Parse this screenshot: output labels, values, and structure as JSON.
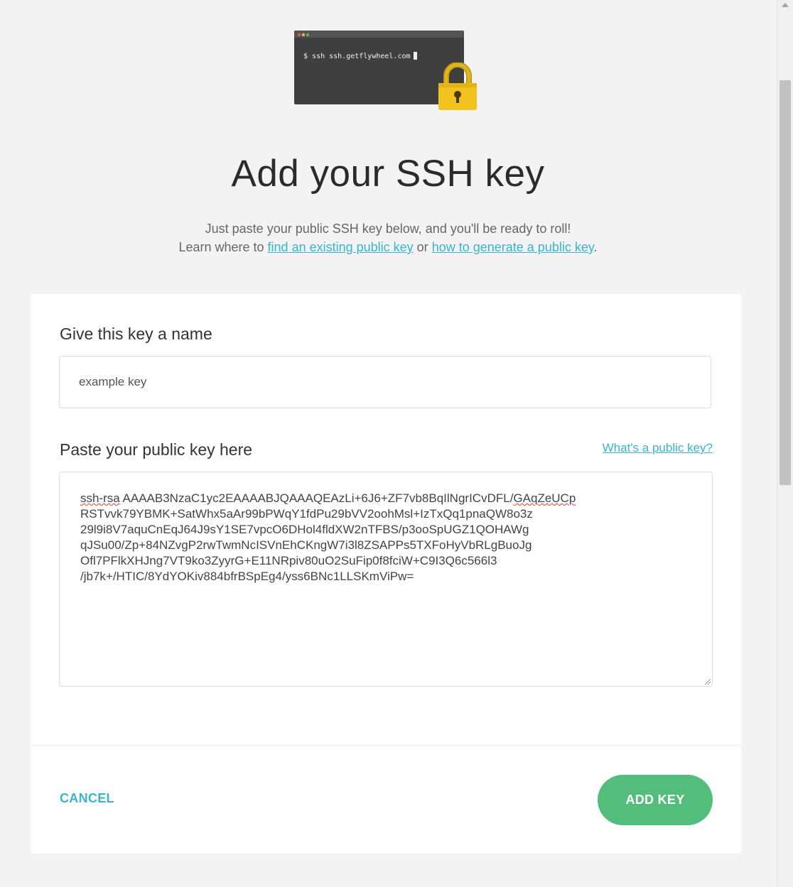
{
  "hero": {
    "terminal_command": "$ ssh ssh.getflywheel.com",
    "terminal_icon": "terminal-window-icon",
    "lock_icon": "padlock-icon"
  },
  "title": "Add your SSH key",
  "subtitle": {
    "line1": "Just paste your public SSH key below, and you'll be ready to roll!",
    "line2_prefix": "Learn where to ",
    "link1": "find an existing public key",
    "middle": " or ",
    "link2": "how to generate a public key",
    "suffix": "."
  },
  "form": {
    "name_label": "Give this key a name",
    "name_value": "example key",
    "key_label": "Paste your public key here",
    "help_link": "What's a public key?",
    "key_prefix": "ssh-rsa",
    "key_part_a": " AAAAB3NzaC1yc2EAAAABJQAAAQEAzLi+6J6+ZF7vb8BqIlNgrICvDFL/",
    "key_flagged": "GAqZeUCp",
    "key_part_b": "\nRSTvvk79YBMK+SatWhx5aAr99bPWqY1fdPu29bVV2oohMsl+IzTxQq1pnaQW8o3z\n29l9i8V7aquCnEqJ64J9sY1SE7vpcO6DHol4fldXW2nTFBS/p3ooSpUGZ1QOHAWg\nqJSu00/Zp+84NZvgP2rwTwmNcISVnEhCKngW7i3l8ZSAPPs5TXFoHyVbRLgBuoJg\nOfl7PFlkXHJng7VT9ko3ZyyrG+E11NRpiv80uO2SuFip0f8fciW+C9I3Q6c566l3\n/jb7k+/HTIC/8YdYOKiv884bfrBSpEg4/yss6BNc1LLSKmViPw="
  },
  "actions": {
    "cancel": "CANCEL",
    "add_key": "ADD KEY"
  },
  "colors": {
    "accent": "#3ab4c8",
    "primary_button": "#53bd7c",
    "lock_gold": "#f2c21f",
    "terminal_bg": "#3f3f3f"
  }
}
